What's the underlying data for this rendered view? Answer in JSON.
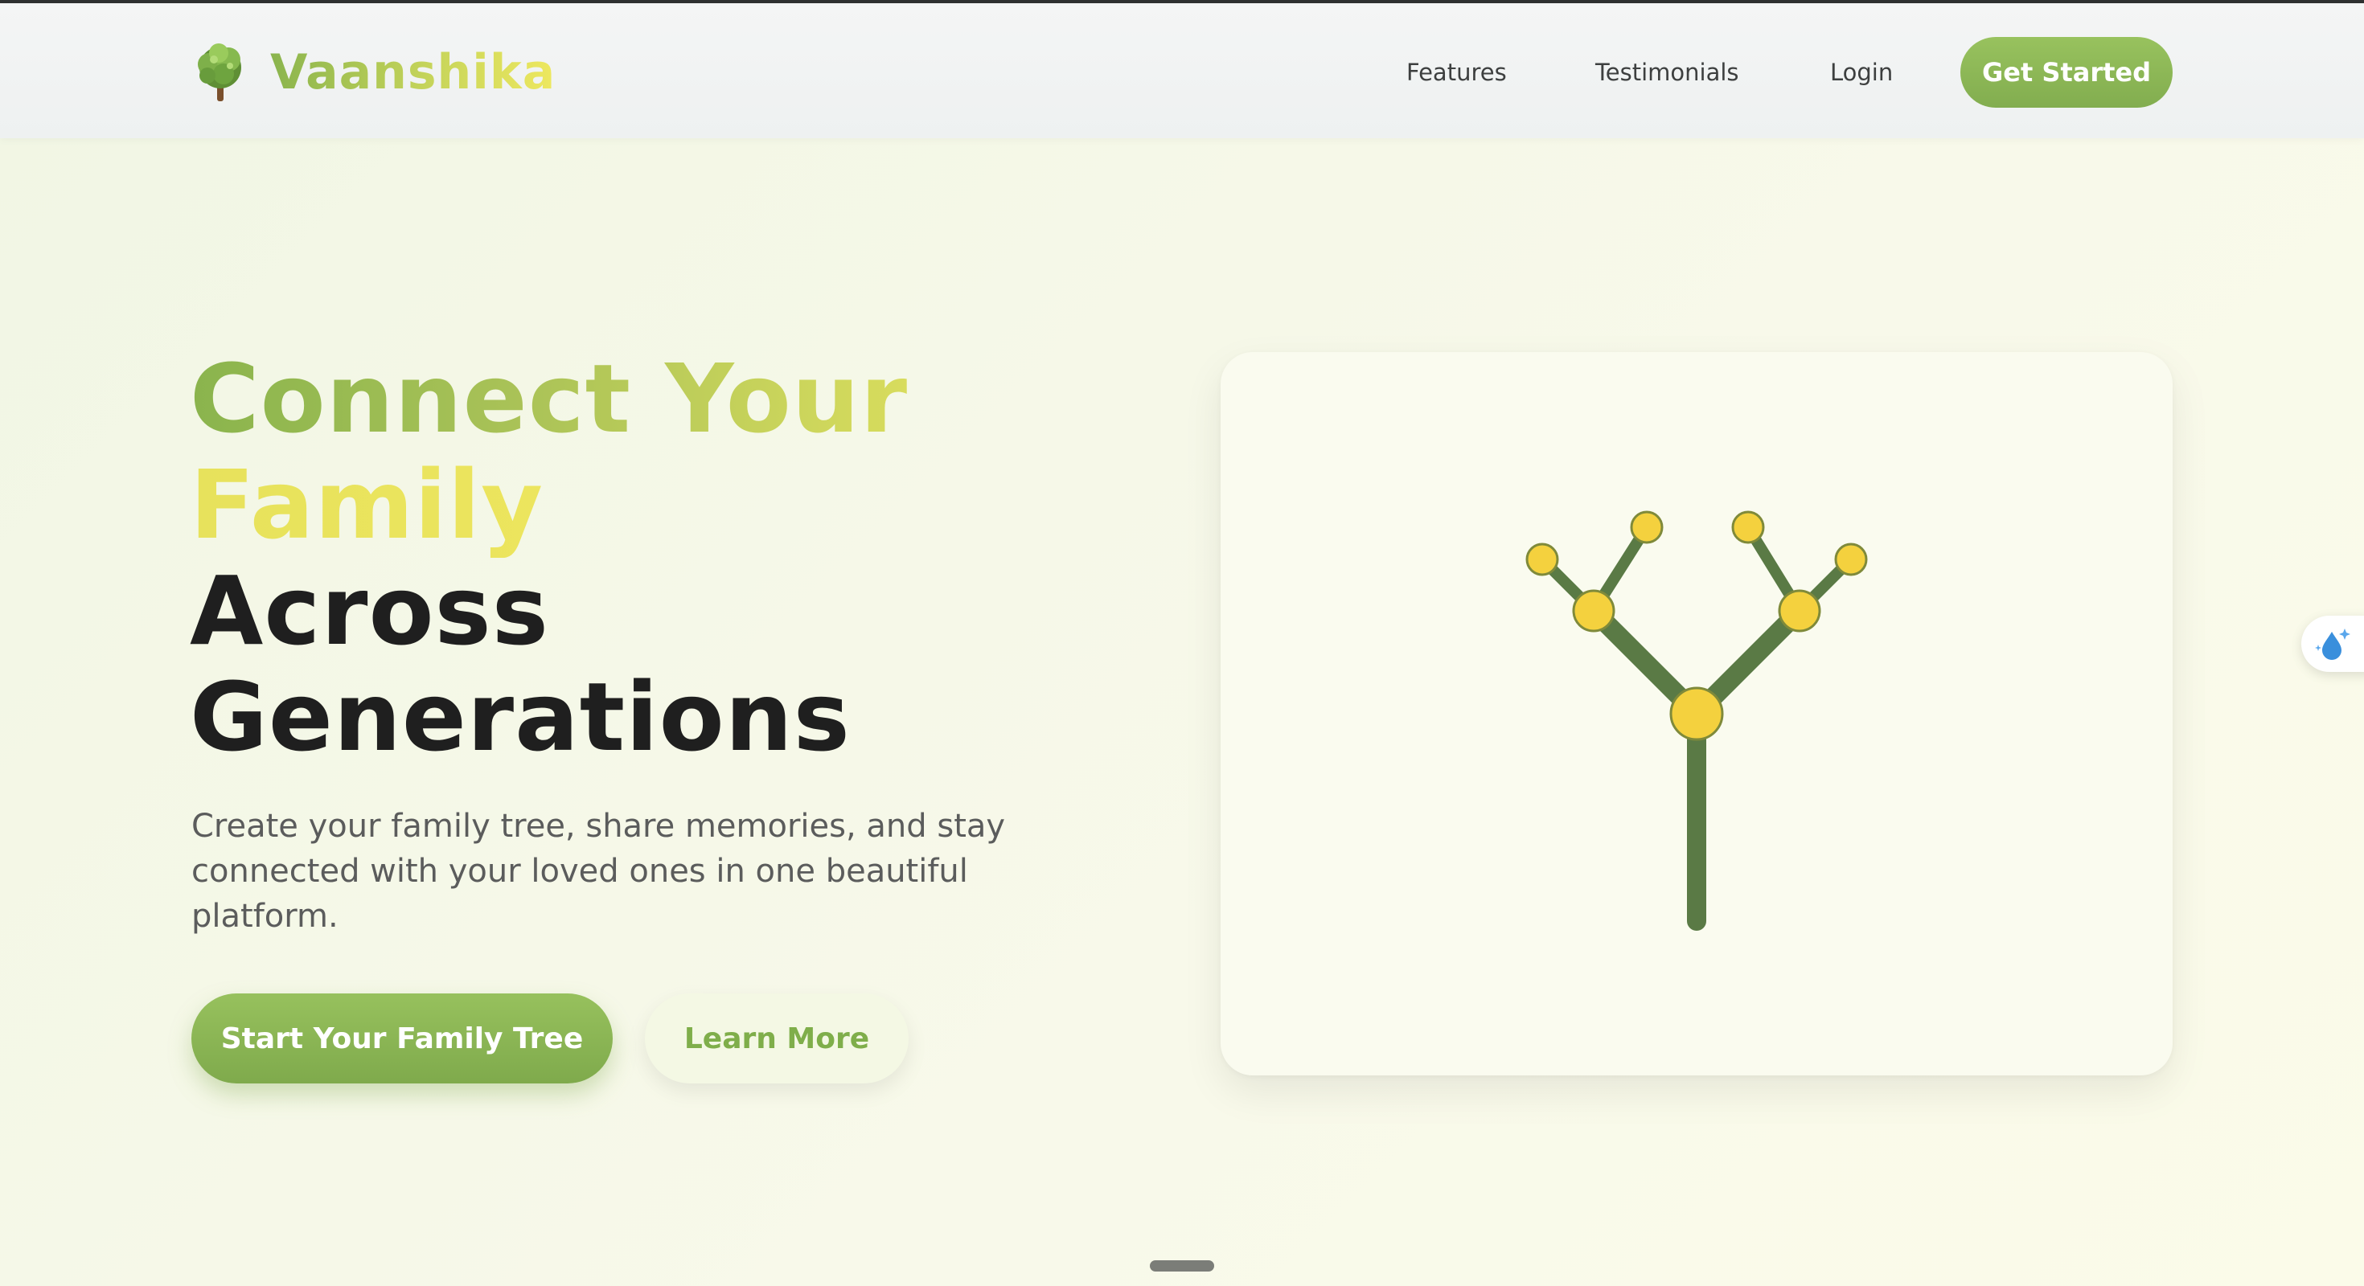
{
  "header": {
    "brand_name": "Vaanshika",
    "nav": {
      "features": "Features",
      "testimonials": "Testimonials",
      "login": "Login",
      "cta": "Get Started"
    }
  },
  "hero": {
    "title_line_1": "Connect Your",
    "title_line_2": "Family",
    "title_line_3": "Across",
    "title_line_4": "Generations",
    "description": "Create your family tree, share memories, and stay connected with your loved ones in one beautiful platform.",
    "primary_button": "Start Your Family Tree",
    "secondary_button": "Learn More"
  },
  "illustration": {
    "icon": "family-tree-icon",
    "branch_color": "#5a7a45",
    "node_color": "#f4d13e",
    "node_stroke": "#7f8a3a"
  },
  "side_widget": {
    "icon": "water-drop-sparkle-icon"
  },
  "colors": {
    "accent_green": "#8ab44d",
    "accent_yellow": "#eee85f",
    "text_dark": "#1f1f1f",
    "text_muted": "#5b5c5c"
  }
}
